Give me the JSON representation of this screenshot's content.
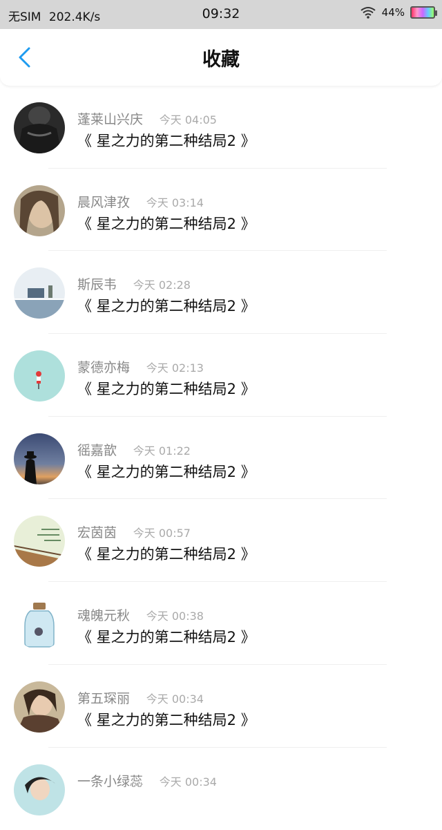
{
  "status": {
    "carrier": "无SIM",
    "speed": "202.4K/s",
    "time": "09:32",
    "battery": "44%"
  },
  "header": {
    "title": "收藏"
  },
  "items": [
    {
      "name": "蓬莱山兴庆",
      "time": "今天 04:05",
      "content": "《 星之力的第二种结局2 》"
    },
    {
      "name": "晨风津孜",
      "time": "今天 03:14",
      "content": "《 星之力的第二种结局2 》"
    },
    {
      "name": "斯辰韦",
      "time": "今天 02:28",
      "content": "《 星之力的第二种结局2 》"
    },
    {
      "name": "蒙德亦梅",
      "time": "今天 02:13",
      "content": "《 星之力的第二种结局2 》"
    },
    {
      "name": "徭嘉歆",
      "time": "今天 01:22",
      "content": "《 星之力的第二种结局2 》"
    },
    {
      "name": "宏茵茵",
      "time": "今天 00:57",
      "content": "《 星之力的第二种结局2 》"
    },
    {
      "name": "魂魄元秋",
      "time": "今天 00:38",
      "content": "《 星之力的第二种结局2 》"
    },
    {
      "name": "第五琛丽",
      "time": "今天 00:34",
      "content": "《 星之力的第二种结局2 》"
    },
    {
      "name": "一条小绿蕊",
      "time": "今天 00:34",
      "content": ""
    }
  ],
  "colors": {
    "accent": "#1e9bf0",
    "statusbar": "#d6d6d6"
  }
}
